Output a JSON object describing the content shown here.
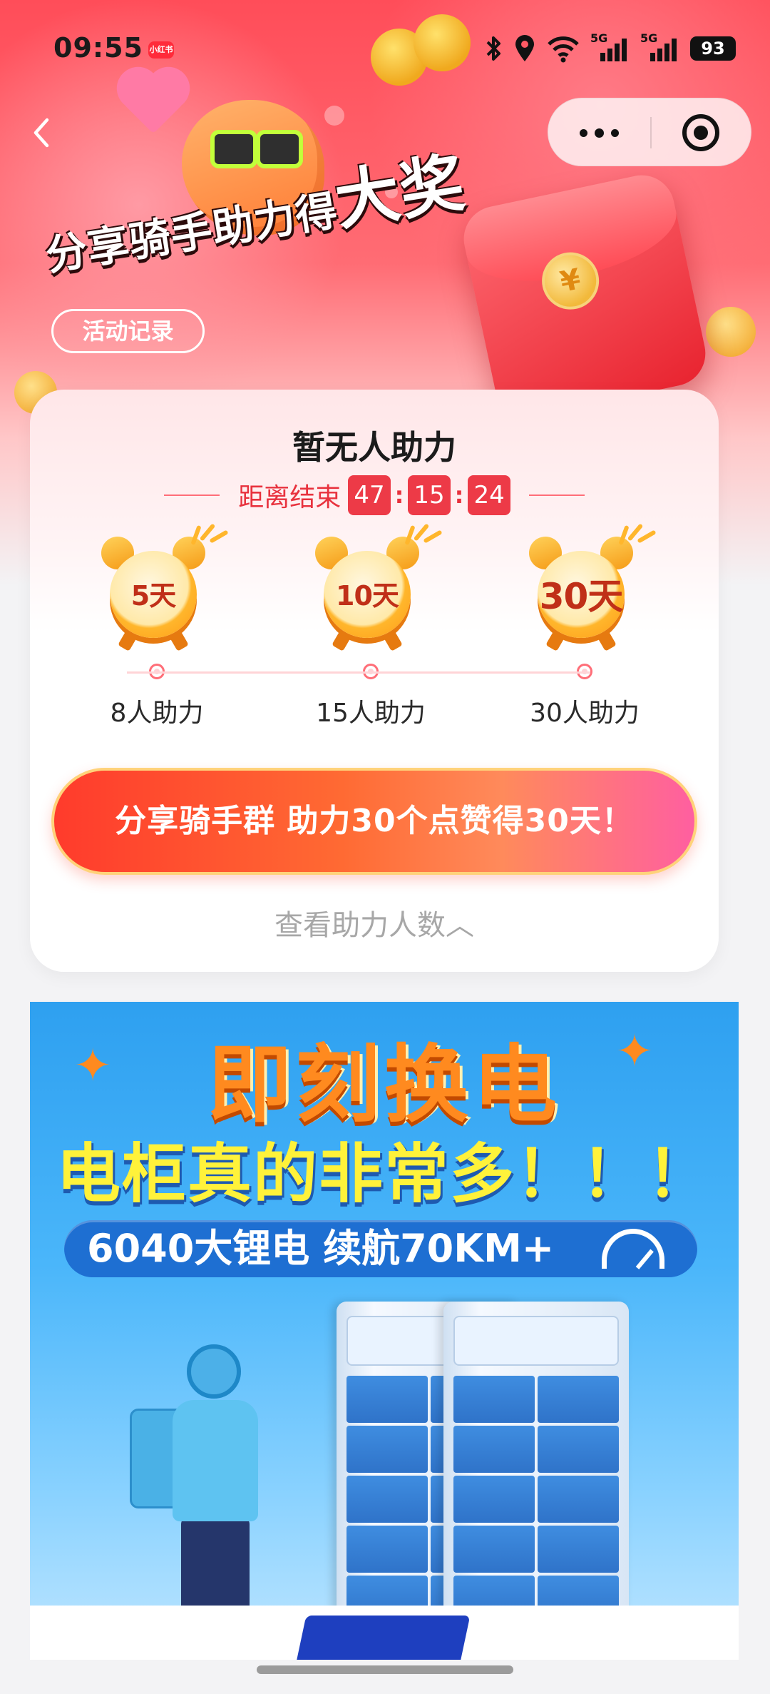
{
  "status_bar": {
    "time": "09:55",
    "app_badge": "小红书",
    "battery": "93",
    "network_1": "5G",
    "network_2": "5G",
    "icons": [
      "bluetooth-icon",
      "location-icon",
      "wifi-icon",
      "signal-icon",
      "signal-icon",
      "battery-icon"
    ]
  },
  "nav": {
    "back_icon": "chevron-left-icon",
    "capsule_more_icon": "more-dots-icon",
    "capsule_close_icon": "target-icon"
  },
  "hero": {
    "title_prefix": "分享骑手助力得",
    "title_big": "大奖",
    "activity_record_label": "活动记录"
  },
  "card": {
    "title": "暂无人助力",
    "countdown_label": "距离结束",
    "countdown": {
      "hours": "47",
      "minutes": "15",
      "seconds": "24"
    },
    "milestones": [
      {
        "days": "5天",
        "label": "8人助力"
      },
      {
        "days": "10天",
        "label": "15人助力"
      },
      {
        "days": "30天",
        "label": "30人助力"
      }
    ],
    "share_button": "分享骑手群 助力30个点赞得30天！",
    "view_count_link": "查看助力人数︿"
  },
  "banner": {
    "headline": "即刻换电",
    "subheadline": "电柜真的非常多！！！",
    "pill_text": "6040大锂电 续航70KM+",
    "gauge_icon": "speedometer-icon"
  },
  "colors": {
    "hero_red": "#ff4d59",
    "accent_red": "#ed3a47",
    "share_gradient_start": "#ff3b2c",
    "share_gradient_end": "#ff5fa0",
    "banner_blue": "#2ea0f0",
    "headline_orange": "#ff8a1f",
    "subheadline_yellow": "#fff23a"
  }
}
